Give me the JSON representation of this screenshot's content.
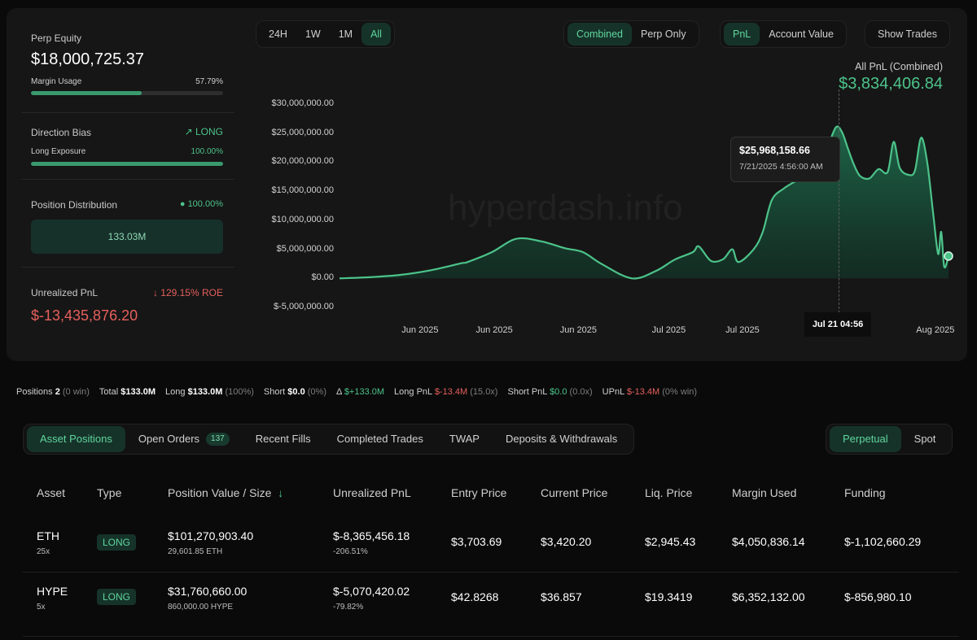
{
  "left": {
    "perp_equity_label": "Perp Equity",
    "perp_equity_value": "$18,000,725.37",
    "margin_usage_label": "Margin Usage",
    "margin_usage_value": "57.79%",
    "margin_usage_fraction": 0.5779,
    "direction_bias_label": "Direction Bias",
    "direction_bias_value": "LONG",
    "long_exposure_label": "Long Exposure",
    "long_exposure_value": "100.00%",
    "long_exposure_fraction": 1.0,
    "position_distribution_label": "Position Distribution",
    "position_distribution_pct": "100.00%",
    "position_distribution_amount": "133.03M",
    "unrealized_pnl_label": "Unrealized PnL",
    "roe_value": "129.15% ROE",
    "unrealized_pnl_value": "$-13,435,876.20"
  },
  "controls": {
    "timeframes": [
      "24H",
      "1W",
      "1M",
      "All"
    ],
    "timeframe_active": "All",
    "mode": [
      "Combined",
      "Perp Only"
    ],
    "mode_active": "Combined",
    "metric": [
      "PnL",
      "Account Value"
    ],
    "metric_active": "PnL",
    "show_trades": "Show Trades"
  },
  "chart_header": {
    "label": "All PnL (Combined)",
    "value": "$3,834,406.84"
  },
  "tooltip": {
    "value": "$25,968,158.66",
    "datetime": "7/21/2025 4:56:00 AM",
    "crosshair_label": "Jul 21 04:56"
  },
  "watermark": "hyperdash.info",
  "chart_data": {
    "type": "area",
    "ylim": [
      -5000000,
      30000000
    ],
    "yticks": [
      "$30,000,000.00",
      "$25,000,000.00",
      "$20,000,000.00",
      "$15,000,000.00",
      "$10,000,000.00",
      "$5,000,000.00",
      "$0.00",
      "$-5,000,000.00"
    ],
    "ytick_values": [
      30000000,
      25000000,
      20000000,
      15000000,
      10000000,
      5000000,
      0,
      -5000000
    ],
    "xticks": [
      "Jun 2025",
      "Jun 2025",
      "Jun 2025",
      "Jul 2025",
      "Jul 2025",
      "Jul 2025",
      "Aug 2025"
    ],
    "xtick_fractions": [
      0.134,
      0.256,
      0.394,
      0.545,
      0.666,
      0.818,
      0.979
    ],
    "color": "#4cc38a",
    "series": [
      {
        "values": [
          [
            0,
            0
          ],
          [
            0.05,
            200000
          ],
          [
            0.1,
            600000
          ],
          [
            0.15,
            1400000
          ],
          [
            0.2,
            2600000
          ],
          [
            0.21,
            2800000
          ],
          [
            0.25,
            4500000
          ],
          [
            0.29,
            6800000
          ],
          [
            0.33,
            6400000
          ],
          [
            0.37,
            5200000
          ],
          [
            0.4,
            4500000
          ],
          [
            0.43,
            2500000
          ],
          [
            0.48,
            0
          ],
          [
            0.52,
            1300000
          ],
          [
            0.55,
            3200000
          ],
          [
            0.58,
            4500000
          ],
          [
            0.59,
            5500000
          ],
          [
            0.61,
            3000000
          ],
          [
            0.63,
            3300000
          ],
          [
            0.645,
            5000000
          ],
          [
            0.655,
            2800000
          ],
          [
            0.68,
            5000000
          ],
          [
            0.695,
            8000000
          ],
          [
            0.71,
            13500000
          ],
          [
            0.73,
            15500000
          ],
          [
            0.75,
            16800000
          ],
          [
            0.76,
            17500000
          ],
          [
            0.77,
            21000000
          ],
          [
            0.78,
            23000000
          ],
          [
            0.79,
            23800000
          ],
          [
            0.8,
            22500000
          ],
          [
            0.815,
            26000000
          ],
          [
            0.825,
            25200000
          ],
          [
            0.835,
            22300000
          ],
          [
            0.845,
            19500000
          ],
          [
            0.855,
            17600000
          ],
          [
            0.87,
            17200000
          ],
          [
            0.885,
            18800000
          ],
          [
            0.9,
            18300000
          ],
          [
            0.91,
            23500000
          ],
          [
            0.92,
            19000000
          ],
          [
            0.935,
            17800000
          ],
          [
            0.945,
            18600000
          ],
          [
            0.955,
            24200000
          ],
          [
            0.965,
            20000000
          ],
          [
            0.975,
            11000000
          ],
          [
            0.983,
            4200000
          ],
          [
            0.988,
            8000000
          ],
          [
            0.993,
            2000000
          ],
          [
            1.0,
            3834406
          ]
        ]
      }
    ]
  },
  "stats": {
    "positions_label": "Positions",
    "positions_value": "2",
    "positions_note": "(0 win)",
    "total_label": "Total",
    "total_value": "$133.0M",
    "long_label": "Long",
    "long_value": "$133.0M",
    "long_note": "(100%)",
    "short_label": "Short",
    "short_value": "$0.0",
    "short_note": "(0%)",
    "delta_label": "Δ",
    "delta_value": "$+133.0M",
    "long_pnl_label": "Long PnL",
    "long_pnl_value": "$-13.4M",
    "long_pnl_note": "(15.0x)",
    "short_pnl_label": "Short PnL",
    "short_pnl_value": "$0.0",
    "short_pnl_note": "(0.0x)",
    "upnl_label": "UPnL",
    "upnl_value": "$-13.4M",
    "upnl_note": "(0% win)"
  },
  "tabs": {
    "asset_positions": "Asset Positions",
    "open_orders": "Open Orders",
    "open_orders_count": "137",
    "recent_fills": "Recent Fills",
    "completed_trades": "Completed Trades",
    "twap": "TWAP",
    "deposits": "Deposits & Withdrawals",
    "perpetual": "Perpetual",
    "spot": "Spot"
  },
  "table": {
    "headers": {
      "asset": "Asset",
      "type": "Type",
      "position_value": "Position Value / Size",
      "unrealized_pnl": "Unrealized PnL",
      "entry_price": "Entry Price",
      "current_price": "Current Price",
      "liq_price": "Liq. Price",
      "margin_used": "Margin Used",
      "funding": "Funding"
    },
    "rows": [
      {
        "asset": "ETH",
        "leverage": "25x",
        "type": "LONG",
        "value": "$101,270,903.40",
        "size": "29,601.85 ETH",
        "pnl": "$-8,365,456.18",
        "pnl_pct": "-206.51%",
        "entry": "$3,703.69",
        "current": "$3,420.20",
        "liq": "$2,945.43",
        "margin": "$4,050,836.14",
        "funding": "$-1,102,660.29"
      },
      {
        "asset": "HYPE",
        "leverage": "5x",
        "type": "LONG",
        "value": "$31,760,660.00",
        "size": "860,000.00 HYPE",
        "pnl": "$-5,070,420.02",
        "pnl_pct": "-79.82%",
        "entry": "$42.8268",
        "current": "$36.857",
        "liq": "$19.3419",
        "margin": "$6,352,132.00",
        "funding": "$-856,980.10"
      }
    ]
  }
}
